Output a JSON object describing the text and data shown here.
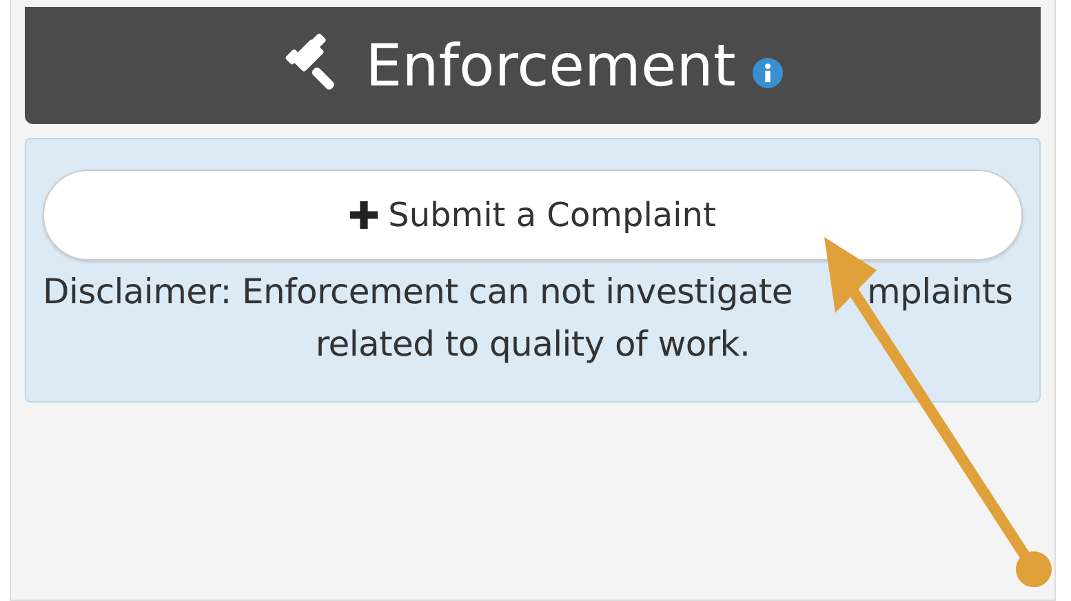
{
  "panel": {
    "title": "Enforcement",
    "button": {
      "label": "Submit a Complaint"
    },
    "disclaimer": {
      "line_1_start": "Disclaimer: Enforcement can not investigate",
      "line_1_end": "mplaints",
      "line_2": "related to quality of work."
    }
  }
}
